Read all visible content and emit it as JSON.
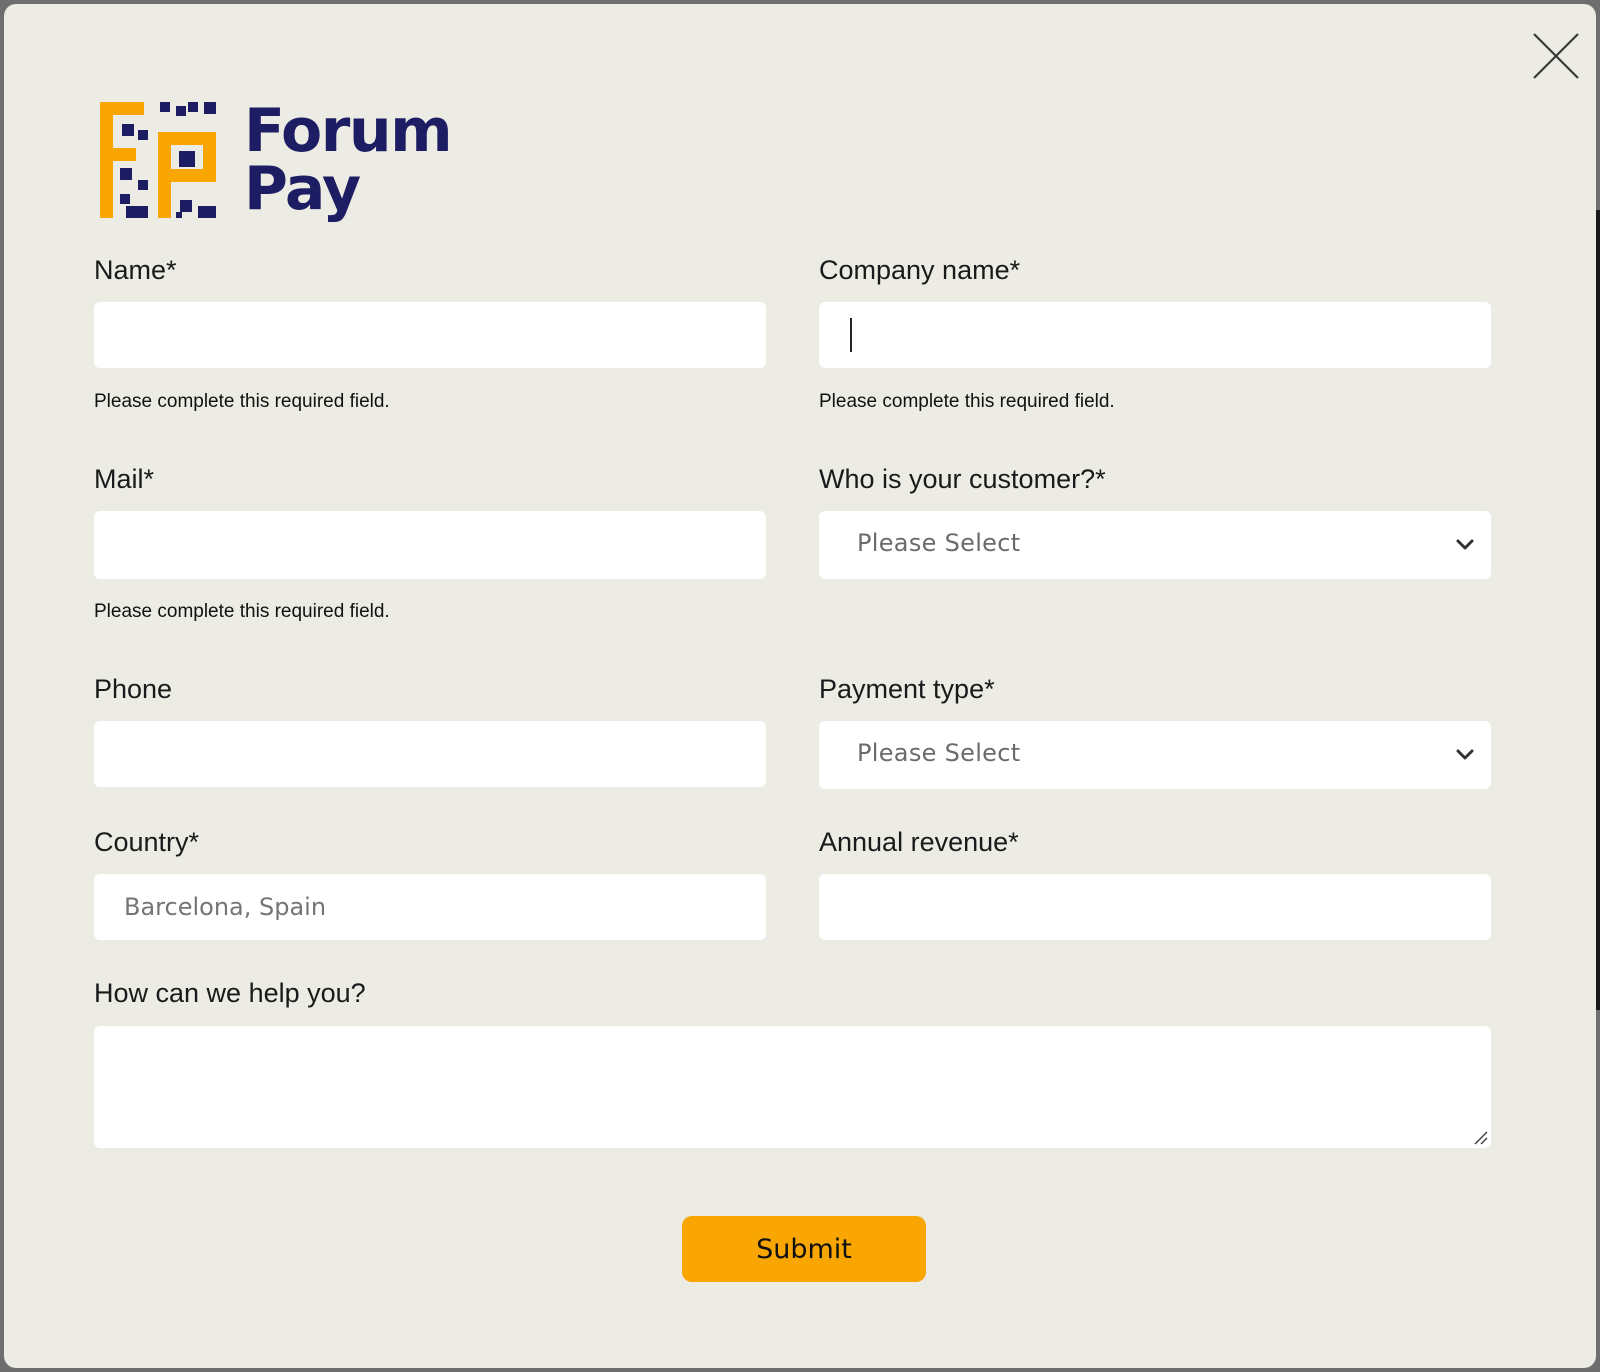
{
  "colors": {
    "brand_navy": "#1d1d63",
    "brand_orange": "#f9a602",
    "modal_background": "#ecebe4",
    "field_background": "#ffffff"
  },
  "logo": {
    "line1": "Forum",
    "line2": "Pay",
    "mark_icon": "forumpay-qr-logo-icon"
  },
  "close": {
    "icon": "close-icon"
  },
  "form": {
    "name": {
      "label": "Name*",
      "value": "",
      "error": "Please complete this required field."
    },
    "company": {
      "label": "Company name*",
      "value": "",
      "error": "Please complete this required field."
    },
    "mail": {
      "label": "Mail*",
      "value": "",
      "error": "Please complete this required field."
    },
    "customer": {
      "label": "Who is your customer?*",
      "selected": "Please Select"
    },
    "phone": {
      "label": "Phone",
      "value": ""
    },
    "payment_type": {
      "label": "Payment type*",
      "selected": "Please Select"
    },
    "country": {
      "label": "Country*",
      "placeholder": "Barcelona, Spain",
      "value": ""
    },
    "revenue": {
      "label": "Annual revenue*",
      "value": ""
    },
    "help": {
      "label": "How can we help you?",
      "value": ""
    },
    "submit_label": "Submit"
  }
}
